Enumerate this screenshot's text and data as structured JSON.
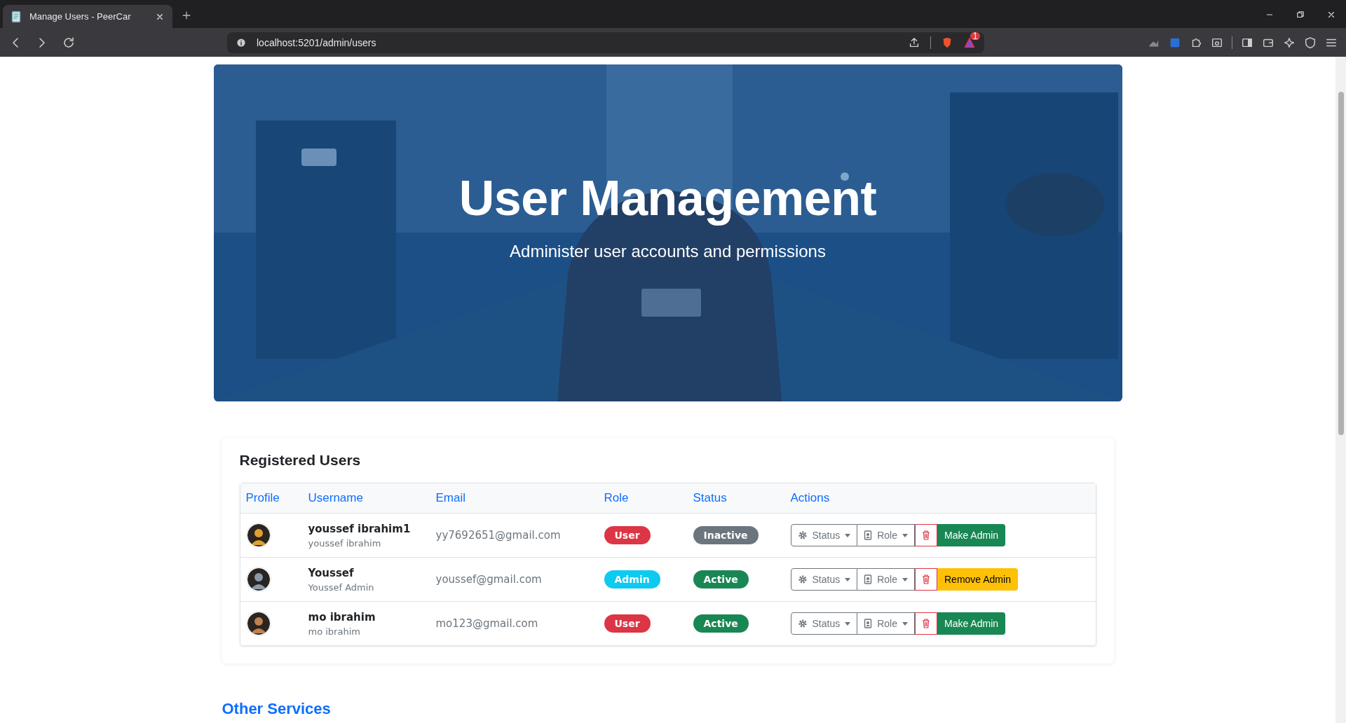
{
  "browser": {
    "tab_title": "Manage Users - PeerCar",
    "url": "localhost:5201/admin/users",
    "notification_count": "1"
  },
  "hero": {
    "title": "User Management",
    "subtitle": "Administer user accounts and permissions"
  },
  "users": {
    "title": "Registered Users",
    "columns": [
      "Profile",
      "Username",
      "Email",
      "Role",
      "Status",
      "Actions"
    ],
    "rows": [
      {
        "username": "youssef ibrahim1",
        "full_name": "youssef ibrahim",
        "email": "yy7692651@gmail.com",
        "role": {
          "label": "User",
          "kind": "user"
        },
        "status": {
          "label": "Inactive",
          "kind": "inactive"
        },
        "actions": {
          "status": "Status",
          "role": "Role",
          "admin": {
            "label": "Make Admin",
            "kind": "make"
          }
        }
      },
      {
        "username": "Youssef",
        "full_name": "Youssef Admin",
        "email": "youssef@gmail.com",
        "role": {
          "label": "Admin",
          "kind": "admin"
        },
        "status": {
          "label": "Active",
          "kind": "active"
        },
        "actions": {
          "status": "Status",
          "role": "Role",
          "admin": {
            "label": "Remove Admin",
            "kind": "remove"
          }
        }
      },
      {
        "username": "mo ibrahim",
        "full_name": "mo ibrahim",
        "email": "mo123@gmail.com",
        "role": {
          "label": "User",
          "kind": "user"
        },
        "status": {
          "label": "Active",
          "kind": "active"
        },
        "actions": {
          "status": "Status",
          "role": "Role",
          "admin": {
            "label": "Make Admin",
            "kind": "make"
          }
        }
      }
    ]
  },
  "other_services": {
    "title": "Other Services"
  }
}
